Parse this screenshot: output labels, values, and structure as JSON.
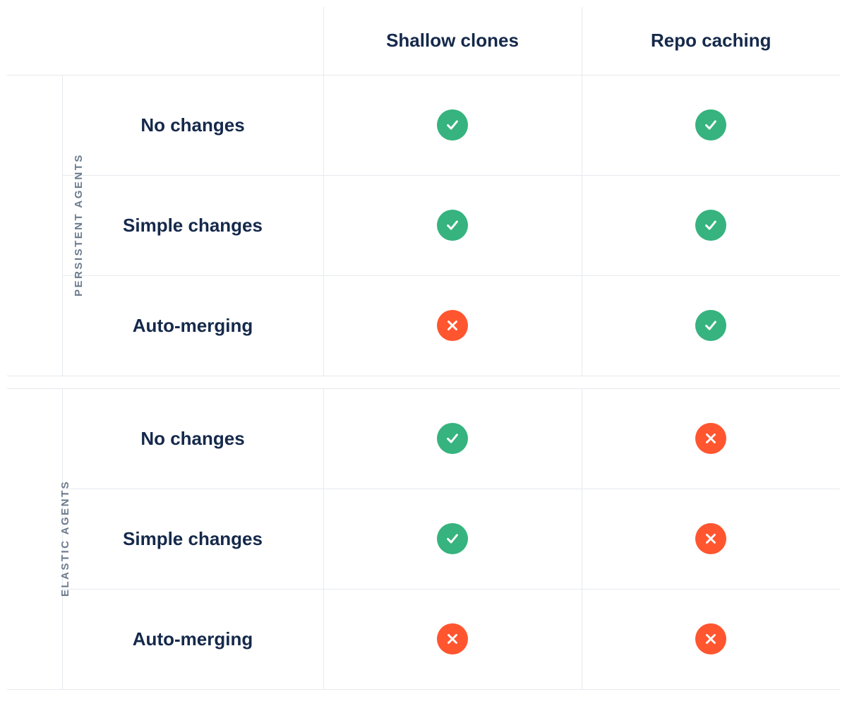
{
  "chart_data": {
    "type": "table",
    "columns": [
      "Shallow clones",
      "Repo caching"
    ],
    "groups": [
      {
        "name": "PERSISTENT AGENTS",
        "rows": [
          {
            "label": "No changes",
            "values": [
              true,
              true
            ]
          },
          {
            "label": "Simple changes",
            "values": [
              true,
              true
            ]
          },
          {
            "label": "Auto-merging",
            "values": [
              false,
              true
            ]
          }
        ]
      },
      {
        "name": "ELASTIC AGENTS",
        "rows": [
          {
            "label": "No changes",
            "values": [
              true,
              false
            ]
          },
          {
            "label": "Simple changes",
            "values": [
              true,
              false
            ]
          },
          {
            "label": "Auto-merging",
            "values": [
              false,
              false
            ]
          }
        ]
      }
    ]
  }
}
